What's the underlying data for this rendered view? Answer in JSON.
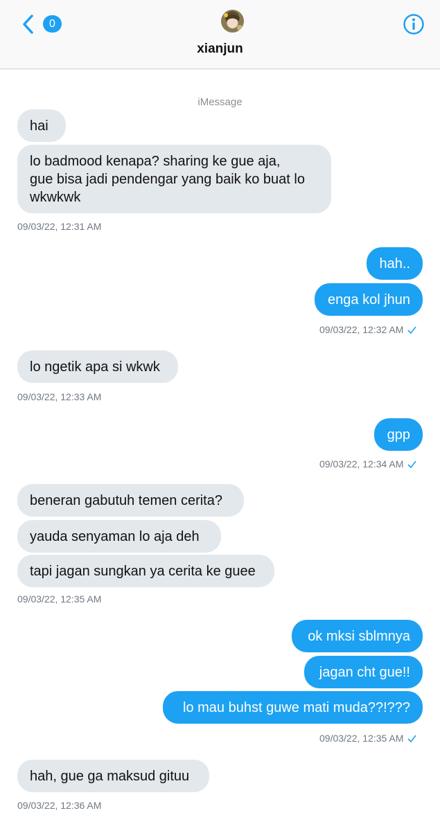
{
  "header": {
    "unread_count": "0",
    "contact_name": "xianjun",
    "back_icon": "chevron-left-icon",
    "info_icon": "info-circle-icon"
  },
  "service_label": "iMessage",
  "accent_color": "#1da1f2",
  "incoming_bubble_color": "#e3e8ed",
  "messages": [
    {
      "text": "hai"
    },
    {
      "lines": [
        "lo badmood kenapa? sharing ke gue  aja,",
        "gue bisa jadi pendengar yang baik ko buat lo",
        "wkwkwk"
      ]
    },
    {
      "text": "hah.."
    },
    {
      "text": "enga kol jhun"
    },
    {
      "text": "lo ngetik apa si wkwk"
    },
    {
      "text": "gpp"
    },
    {
      "text": "beneran gabutuh temen cerita?"
    },
    {
      "text": "yauda senyaman lo aja deh"
    },
    {
      "text": "tapi jagan sungkan ya cerita ke guee"
    },
    {
      "text": "ok mksi sblmnya"
    },
    {
      "text": "jagan cht gue!!"
    },
    {
      "text": "lo mau buhst guwe mati muda??!???"
    },
    {
      "text": "hah, gue ga maksud gituu"
    }
  ],
  "timestamps": [
    "09/03/22, 12:31 AM",
    "09/03/22, 12:32 AM",
    "09/03/22, 12:33 AM",
    "09/03/22, 12:34 AM",
    "09/03/22, 12:35 AM",
    "09/03/22, 12:35 AM",
    "09/03/22, 12:36 AM"
  ]
}
